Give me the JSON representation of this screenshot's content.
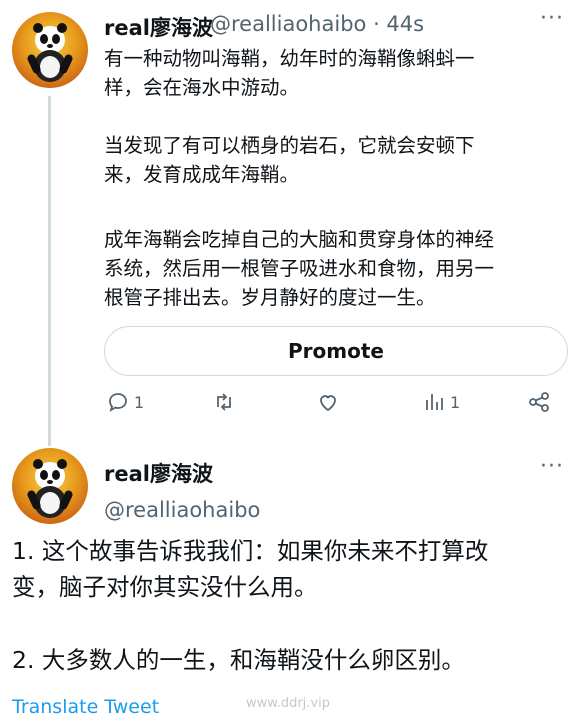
{
  "tweet1": {
    "name": "real廖海波",
    "handle": "@realliaohaibo",
    "time": "· 44s",
    "para1": "有一种动物叫海鞘，幼年时的海鞘像蝌蚪一\n样，会在海水中游动。",
    "para2": "当发现了有可以栖身的岩石，它就会安顿下\n来，发育成成年海鞘。",
    "para3": "成年海鞘会吃掉自己的大脑和贯穿身体的神经\n系统，然后用一根管子吸进水和食物，用另一\n根管子排出去。岁月静好的度过一生。",
    "promote_label": "Promote",
    "reply_count": "1",
    "views_count": "1"
  },
  "tweet2": {
    "name": "real廖海波",
    "handle": "@realliaohaibo",
    "line1": "1. 这个故事告诉我我们：如果你未来不打算改\n变，脑子对你其实没什么用。",
    "line2": "2. 大多数人的一生，和海鞘没什么卵区别。",
    "translate": "Translate Tweet"
  },
  "watermark": "www.ddrj.vip",
  "icons": [
    "more-icon",
    "reply-icon",
    "retweet-icon",
    "like-icon",
    "views-icon",
    "share-icon",
    "avatar-panda"
  ],
  "colors": {
    "link": "#1d9bf0",
    "muted": "#536471",
    "border": "#cfd9de"
  }
}
